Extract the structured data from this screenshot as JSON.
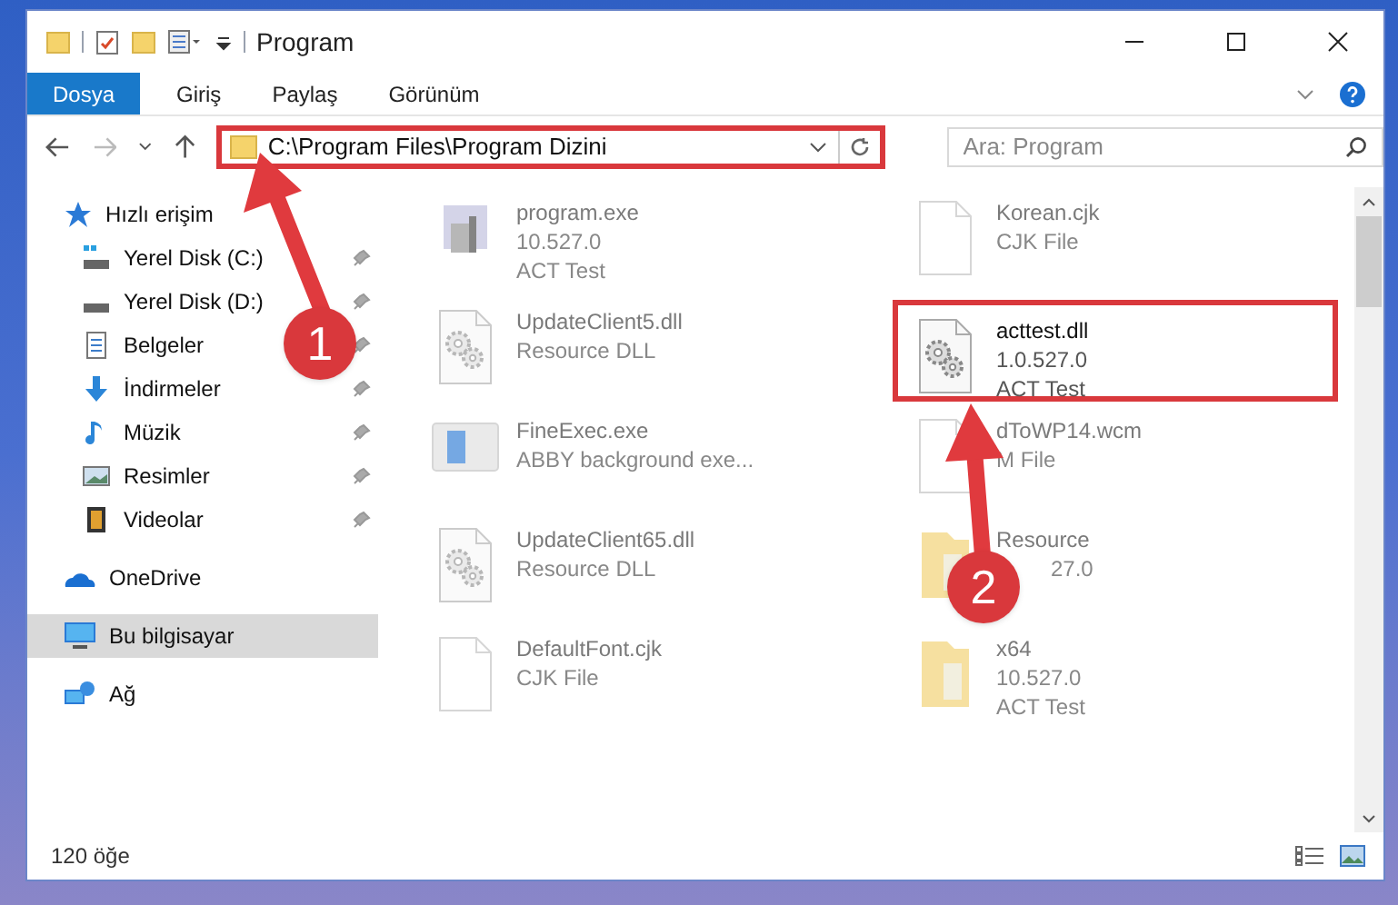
{
  "window": {
    "title": "Program"
  },
  "ribbon_tabs": [
    {
      "label": "Dosya",
      "selected": true
    },
    {
      "label": "Giriş",
      "selected": false
    },
    {
      "label": "Paylaş",
      "selected": false
    },
    {
      "label": "Görünüm",
      "selected": false
    }
  ],
  "address_bar": {
    "path": "C:\\Program Files\\Program Dizini",
    "annotated": true
  },
  "search": {
    "placeholder": "Ara: Program"
  },
  "sidebar": {
    "items": [
      {
        "label": "Hızlı erişim",
        "selected": false,
        "children": [
          {
            "label": "Yerel Disk (C:)",
            "pinned": true
          },
          {
            "label": "Yerel Disk (D:)",
            "pinned": true
          },
          {
            "label": "Belgeler",
            "pinned": true
          },
          {
            "label": "İndirmeler",
            "pinned": true
          },
          {
            "label": "Müzik",
            "pinned": true
          },
          {
            "label": "Resimler",
            "pinned": true
          },
          {
            "label": "Videolar",
            "pinned": true
          }
        ]
      },
      {
        "label": "OneDrive",
        "selected": false
      },
      {
        "label": "Bu bilgisayar",
        "selected": true
      },
      {
        "label": "Ağ",
        "selected": false
      }
    ]
  },
  "files": [
    {
      "kind": "exe",
      "name": "program.exe",
      "lines": [
        "10.527.0",
        "ACT Test"
      ],
      "annotated": false,
      "blurred": true
    },
    {
      "kind": "doc",
      "name": "Korean.cjk",
      "lines": [
        "CJK File"
      ],
      "annotated": false,
      "blurred": true
    },
    {
      "kind": "dll",
      "name": "UpdateClient5.dll",
      "lines": [
        "Resource DLL"
      ],
      "annotated": false,
      "blurred": true
    },
    {
      "kind": "dll",
      "name": "acttest.dll",
      "lines": [
        "1.0.527.0",
        "ACT Test"
      ],
      "annotated": true,
      "blurred": false
    },
    {
      "kind": "window",
      "name": "FineExec.exe",
      "lines": [
        "ABBY background exe..."
      ],
      "annotated": false,
      "blurred": true
    },
    {
      "kind": "doc",
      "name": "dToWP14.wcm",
      "lines": [
        "M File"
      ],
      "annotated": false,
      "blurred": true
    },
    {
      "kind": "dll",
      "name": "UpdateClient65.dll",
      "lines": [
        "Resource DLL"
      ],
      "annotated": false,
      "blurred": true
    },
    {
      "kind": "folder",
      "name": "Resource",
      "lines": [
        "27.0"
      ],
      "annotated": false,
      "blurred": true,
      "covered": true
    },
    {
      "kind": "doc",
      "name": "DefaultFont.cjk",
      "lines": [
        "CJK File"
      ],
      "annotated": false,
      "blurred": true
    },
    {
      "kind": "folder",
      "name": "x64",
      "lines": [
        "10.527.0",
        "ACT Test"
      ],
      "annotated": false,
      "blurred": true
    }
  ],
  "status_bar": {
    "item_count": "120 öğe"
  },
  "annotations": [
    {
      "label": "1"
    },
    {
      "label": "2"
    }
  ]
}
